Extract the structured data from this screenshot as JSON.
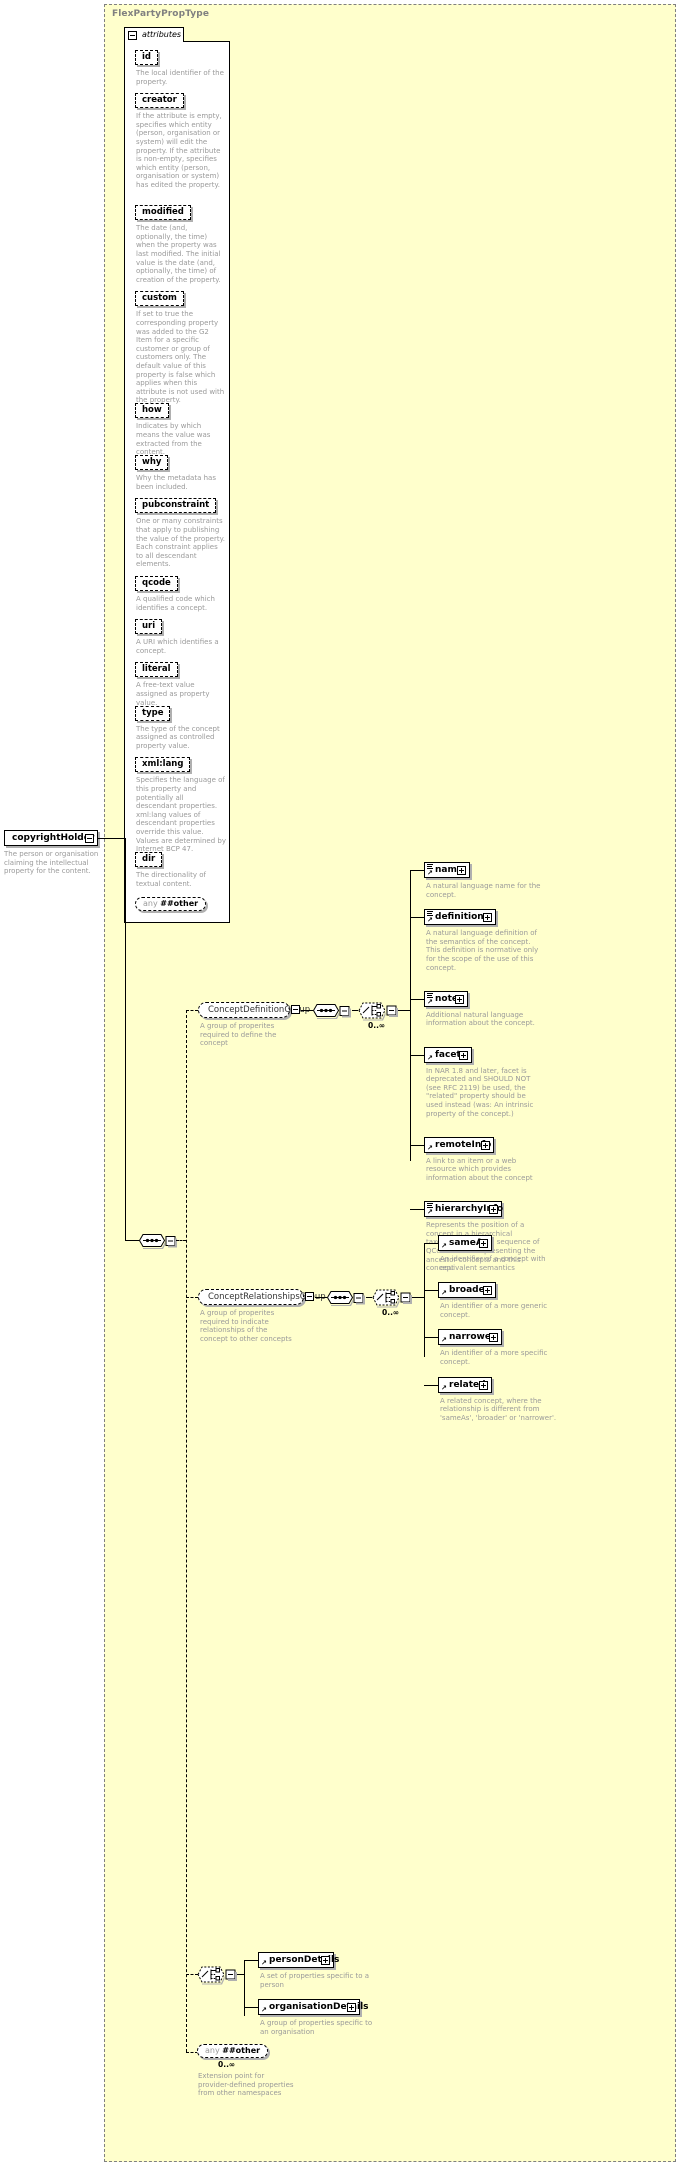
{
  "diagram": {
    "type_name": "FlexPartyPropType",
    "attributes_label": "attributes",
    "root_element": {
      "name": "copyrightHolder",
      "doc": "The person or organisation claiming the intellectual property for the content."
    },
    "attributes": [
      {
        "name": "id",
        "doc": "The local identifier of the property."
      },
      {
        "name": "creator",
        "doc": "If the attribute is empty, specifies which entity (person, organisation or system) will edit the property. If the attribute is non-empty, specifies which entity (person, organisation or system) has edited the property."
      },
      {
        "name": "modified",
        "doc": "The date (and, optionally, the time) when the property was last modified. The initial value is the date (and, optionally, the time) of creation of the property."
      },
      {
        "name": "custom",
        "doc": "If set to true the corresponding property was added to the G2 Item for a specific customer or group of customers only. The default value of this property is false which applies when this attribute is not used with the property."
      },
      {
        "name": "how",
        "doc": "Indicates by which means the value was extracted from the content."
      },
      {
        "name": "why",
        "doc": "Why the metadata has been included."
      },
      {
        "name": "pubconstraint",
        "doc": "One or many constraints that apply to publishing the value of the property. Each constraint applies to all descendant elements."
      },
      {
        "name": "qcode",
        "doc": "A qualified code which identifies a concept."
      },
      {
        "name": "uri",
        "doc": "A URI which identifies a concept."
      },
      {
        "name": "literal",
        "doc": "A free-text value assigned as property value."
      },
      {
        "name": "type",
        "doc": "The type of the concept assigned as controlled property value."
      },
      {
        "name": "xml:lang",
        "doc": "Specifies the language of this property and potentially all descendant properties. xml:lang values of descendant properties override this value. Values are determined by Internet BCP 47."
      },
      {
        "name": "dir",
        "doc": "The directionality of textual content."
      }
    ],
    "attribute_wildcard": {
      "any_label": "any",
      "namespace": "##other"
    },
    "groups": [
      {
        "name": "ConceptDefinitionGroup",
        "doc": "A group of properites required to define the concept",
        "occurs": "0..∞",
        "children": [
          {
            "name": "name",
            "doc": "A natural language name for the concept."
          },
          {
            "name": "definition",
            "doc": "A natural language definition of the semantics of the concept. This definition is normative only for the scope of the use of this concept."
          },
          {
            "name": "note",
            "doc": "Additional natural language information about the concept."
          },
          {
            "name": "facet",
            "doc": "In NAR 1.8 and later, facet is deprecated and SHOULD NOT (see RFC 2119) be used, the \"related\" property should be used instead (was: An intrinsic property of the concept.)"
          },
          {
            "name": "remoteInfo",
            "doc": "A link to an item or a web resource which provides information about the concept"
          },
          {
            "name": "hierarchyInfo",
            "doc": "Represents the position of a concept in a hierarchical taxonomy tree by a sequence of QCode tokens representing the ancestor concepts and this concept"
          }
        ]
      },
      {
        "name": "ConceptRelationshipsGroup",
        "doc": "A group of properites required to indicate relationships of the concept to other concepts",
        "occurs": "0..∞",
        "children": [
          {
            "name": "sameAs",
            "doc": "An identifier of a concept with equivalent semantics"
          },
          {
            "name": "broader",
            "doc": "An identifier of a more generic concept."
          },
          {
            "name": "narrower",
            "doc": "An identifier of a more specific concept."
          },
          {
            "name": "related",
            "doc": "A related concept, where the relationship is different from 'sameAs', 'broader' or 'narrower'."
          }
        ]
      }
    ],
    "detail_choice": {
      "children": [
        {
          "name": "personDetails",
          "doc": "A set of properties specific to a person"
        },
        {
          "name": "organisationDetails",
          "doc": "A group of properties specific to an organisation"
        }
      ]
    },
    "element_wildcard": {
      "any_label": "any",
      "namespace": "##other",
      "occurs": "0..∞",
      "doc": "Extension point for provider-defined properties from other namespaces"
    }
  }
}
